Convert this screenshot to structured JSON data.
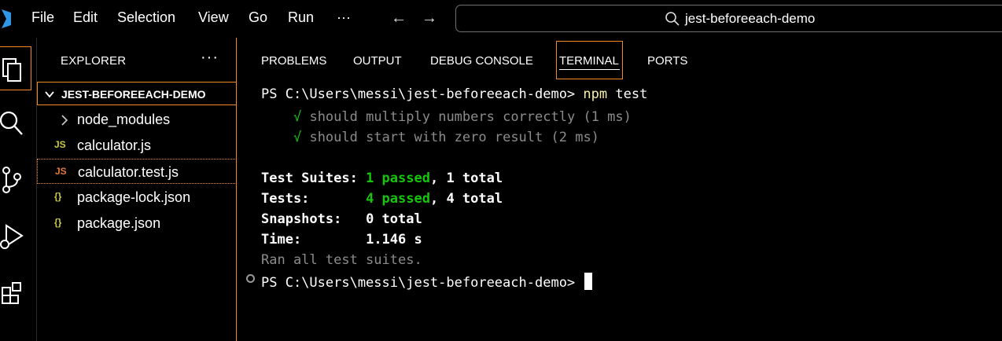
{
  "menu": {
    "items": [
      "File",
      "Edit",
      "Selection",
      "View",
      "Go",
      "Run",
      "···"
    ],
    "back_arrow": "←",
    "forward_arrow": "→"
  },
  "search": {
    "text": "jest-beforeeach-demo"
  },
  "activity": {
    "icons": [
      "explorer-icon",
      "search-icon",
      "source-control-icon",
      "run-debug-icon",
      "extensions-icon"
    ]
  },
  "sidebar": {
    "title": "EXPLORER",
    "more": "···",
    "folder": "JEST-BEFOREEACH-DEMO",
    "items": [
      {
        "label": "node_modules",
        "icon": "›",
        "icon_color": "#cccccc"
      },
      {
        "label": "calculator.js",
        "icon": "JS",
        "icon_color": "#cbcb41"
      },
      {
        "label": "calculator.test.js",
        "icon": "JS",
        "icon_color": "#e37933"
      },
      {
        "label": "package-lock.json",
        "icon": "{}",
        "icon_color": "#cbcb41"
      },
      {
        "label": "package.json",
        "icon": "{}",
        "icon_color": "#cbcb41"
      }
    ]
  },
  "panel": {
    "tabs": [
      "PROBLEMS",
      "OUTPUT",
      "DEBUG CONSOLE",
      "TERMINAL",
      "PORTS"
    ],
    "active_tab": "TERMINAL"
  },
  "terminal": {
    "prompt": "PS C:\\Users\\messi\\jest-beforeeach-demo>",
    "command_npm": "npm",
    "command_arg": "test",
    "test_lines": [
      {
        "check": "√",
        "text": "should multiply numbers correctly (1 ms)"
      },
      {
        "check": "√",
        "text": "should start with zero result (2 ms)"
      }
    ],
    "summary": {
      "suites_label": "Test Suites:",
      "suites_passed": "1 passed",
      "suites_total": ", 1 total",
      "tests_label": "Tests:",
      "tests_passed": "4 passed",
      "tests_total": ", 4 total",
      "snapshots_label": "Snapshots:",
      "snapshots_value": "0 total",
      "time_label": "Time:",
      "time_value": "1.146 s"
    },
    "ran_all": "Ran all test suites.",
    "prompt2": "PS C:\\Users\\messi\\jest-beforeeach-demo>"
  },
  "colors": {
    "accent": "#f38a28",
    "pass_green": "#16c60c",
    "npm_yellow": "#f9f1a5"
  }
}
